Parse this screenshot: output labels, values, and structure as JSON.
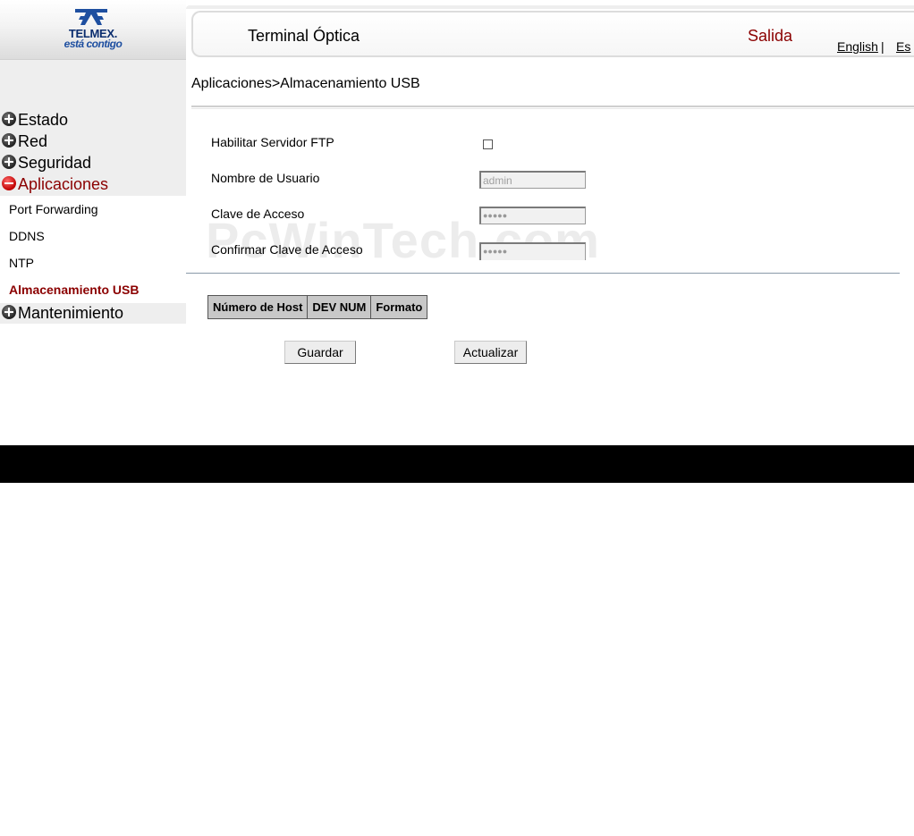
{
  "brand": {
    "name": "TELMEX.",
    "tagline": "está contigo"
  },
  "header": {
    "title": "Terminal Óptica",
    "logout": "Salida",
    "lang_english": "English",
    "lang_sep": "|",
    "lang_es": "Es"
  },
  "sidebar": {
    "items": [
      {
        "label": "Estado",
        "state": "collapsed"
      },
      {
        "label": "Red",
        "state": "collapsed"
      },
      {
        "label": "Seguridad",
        "state": "collapsed"
      },
      {
        "label": "Aplicaciones",
        "state": "expanded"
      },
      {
        "label": "Mantenimiento",
        "state": "collapsed"
      }
    ],
    "subitems": [
      {
        "label": "Port Forwarding"
      },
      {
        "label": "DDNS"
      },
      {
        "label": "NTP"
      },
      {
        "label": "Almacenamiento USB",
        "active": true
      }
    ]
  },
  "breadcrumb": "Aplicaciones>Almacenamiento USB",
  "form": {
    "ftp_label": "Habilitar Servidor FTP",
    "ftp_checked": false,
    "username_label": "Nombre de Usuario",
    "username_value": "admin",
    "password_label": "Clave de Acceso",
    "password_mask": "●●●●●",
    "confirm_label": "Confirmar Clave de Acceso",
    "confirm_mask": "●●●●●"
  },
  "table": {
    "headers": [
      "Número de Host",
      "DEV NUM",
      "Formato"
    ]
  },
  "buttons": {
    "save": "Guardar",
    "refresh": "Actualizar"
  },
  "watermark": "PcWinTech.com",
  "colors": {
    "accent_red": "#8b0000",
    "sidebar_bg": "#eeeeee",
    "footer": "#000000",
    "logo_blue": "#1e4fa0"
  }
}
